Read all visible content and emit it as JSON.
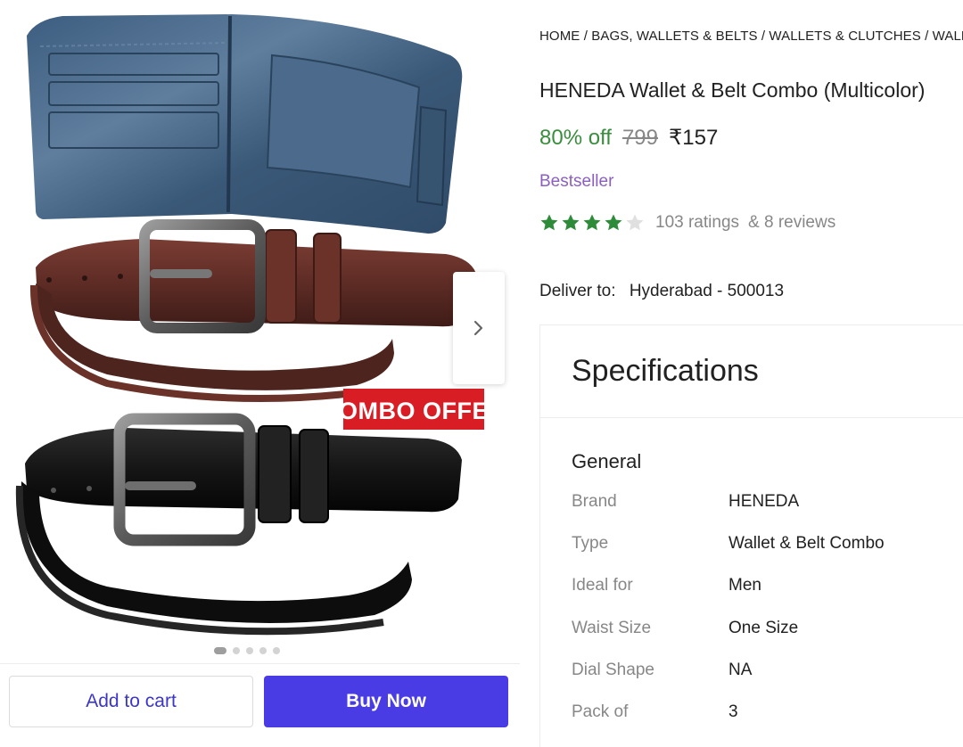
{
  "gallery": {
    "badge_text": "COMBO OFFER",
    "dots_count": 5,
    "active_dot": 0
  },
  "actions": {
    "add_to_cart": "Add to cart",
    "buy_now": "Buy Now"
  },
  "breadcrumb": [
    "HOME",
    "BAGS, WALLETS & BELTS",
    "WALLETS & CLUTCHES",
    "WALLETS"
  ],
  "product": {
    "title": "HENEDA Wallet & Belt Combo (Multicolor)",
    "discount": "80% off",
    "mrp": "799",
    "price": "₹157",
    "badge": "Bestseller",
    "rating_value": 4,
    "rating_max": 5,
    "ratings_count": "103 ratings",
    "reviews_count": "& 8 reviews"
  },
  "delivery": {
    "label": "Deliver to:",
    "location": "Hyderabad - 500013"
  },
  "specifications": {
    "title": "Specifications",
    "section": "General",
    "rows": [
      {
        "key": "Brand",
        "value": "HENEDA"
      },
      {
        "key": "Type",
        "value": "Wallet & Belt Combo"
      },
      {
        "key": "Ideal for",
        "value": "Men"
      },
      {
        "key": "Waist Size",
        "value": "One Size"
      },
      {
        "key": "Dial Shape",
        "value": "NA"
      },
      {
        "key": "Pack of",
        "value": "3"
      }
    ]
  },
  "colors": {
    "discount_green": "#388e3c",
    "bestseller_purple": "#8b5fbf",
    "star_green": "#2e8b3a",
    "buy_button": "#4a3ce5",
    "cart_text": "#3c36c9"
  },
  "icons": {
    "next_arrow": "chevron-right-icon",
    "star": "star-icon"
  }
}
